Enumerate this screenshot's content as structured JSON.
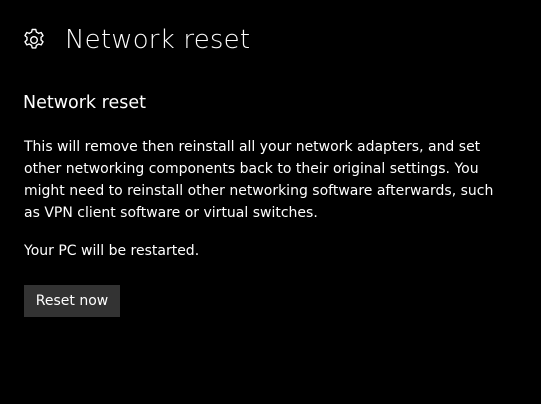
{
  "header": {
    "icon": "gear-icon",
    "title": "Network reset"
  },
  "section": {
    "heading": "Network reset",
    "description_lines": [
      "This will remove then reinstall all your network adapters, and set",
      "other networking components back to their original settings. You",
      "might need to reinstall other networking software afterwards, such",
      "as VPN client software or virtual switches."
    ],
    "restart_note": "Your PC will be restarted.",
    "reset_button_label": "Reset now"
  },
  "colors": {
    "background": "#000000",
    "text": "#ffffff",
    "button_background": "#333333"
  }
}
